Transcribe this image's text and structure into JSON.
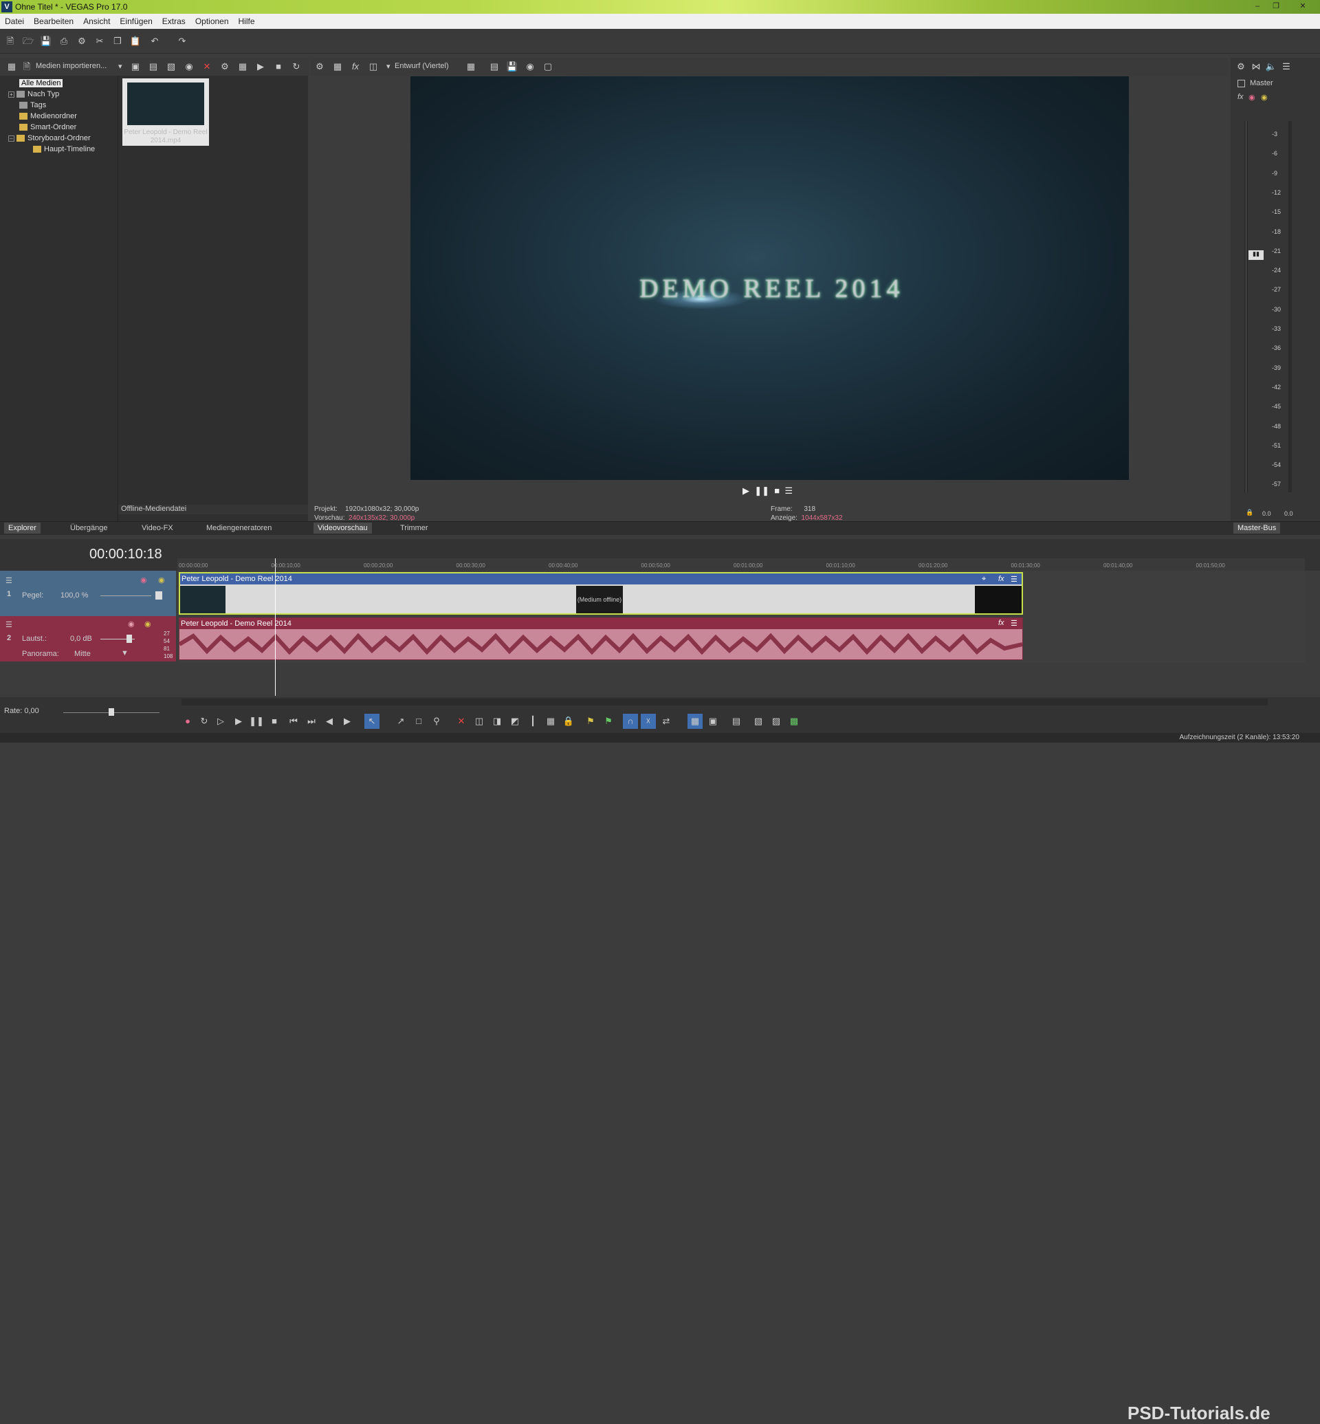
{
  "window": {
    "title": "Ohne Titel * - VEGAS Pro 17.0",
    "logo": "V"
  },
  "menu": [
    "Datei",
    "Bearbeiten",
    "Ansicht",
    "Einfügen",
    "Extras",
    "Optionen",
    "Hilfe"
  ],
  "media": {
    "import_label": "Medien importieren...",
    "tree": [
      {
        "label": "Alle Medien"
      },
      {
        "label": "Nach Typ"
      },
      {
        "label": "Tags"
      },
      {
        "label": "Medienordner"
      },
      {
        "label": "Smart-Ordner"
      },
      {
        "label": "Storyboard-Ordner"
      },
      {
        "label": "Haupt-Timeline"
      }
    ],
    "thumb_caption": "Peter Leopold - Demo Reel 2014.mp4",
    "status": "Offline-Mediendatei"
  },
  "preview": {
    "quality": "Entwurf (Viertel)",
    "video_title": "DEMO REEL 2014",
    "project_label": "Projekt:",
    "project_value": "1920x1080x32; 30,000p",
    "preview_label": "Vorschau:",
    "preview_value": "240x135x32; 30,000p",
    "frame_label": "Frame:",
    "frame_value": "318",
    "display_label": "Anzeige:",
    "display_value": "1044x587x32"
  },
  "master": {
    "label": "Master",
    "db": [
      "-3",
      "-6",
      "-9",
      "-12",
      "-15",
      "-18",
      "-21",
      "-24",
      "-27",
      "-30",
      "-33",
      "-36",
      "-39",
      "-42",
      "-45",
      "-48",
      "-51",
      "-54",
      "-57"
    ],
    "left_val": "0.0",
    "right_val": "0.0"
  },
  "tabs": {
    "explorer": "Explorer",
    "transitions": "Übergänge",
    "videofx": "Video-FX",
    "generators": "Mediengeneratoren",
    "videopreview": "Videovorschau",
    "trimmer": "Trimmer",
    "masterbus": "Master-Bus"
  },
  "timeline": {
    "timecode": "00:00:10:18",
    "ruler": [
      "00:00:00;00",
      "00:00:10;00",
      "00:00:20;00",
      "00:00:30;00",
      "00:00:40;00",
      "00:00:50;00",
      "00:01:00;00",
      "00:01:10;00",
      "00:01:20;00",
      "00:01:30;00",
      "00:01:40;00",
      "00:01:50;00"
    ],
    "track1": {
      "number": "1",
      "level_label": "Pegel:",
      "level_value": "100,0 %",
      "clip": "Peter Leopold - Demo Reel 2014",
      "offline": "(Medium offline)"
    },
    "track2": {
      "number": "2",
      "vol_label": "Lautst.:",
      "vol_value": "0,0 dB",
      "pan_label": "Panorama:",
      "pan_value": "Mitte",
      "clip": "Peter Leopold - Demo Reel 2014",
      "scale": [
        "27",
        "54",
        "81",
        "108"
      ]
    }
  },
  "bottom": {
    "rate": "Rate: 0,00"
  },
  "status": {
    "text": "Aufzeichnungszeit (2 Kanäle): 13:53:20"
  },
  "watermark": "PSD-Tutorials.de"
}
